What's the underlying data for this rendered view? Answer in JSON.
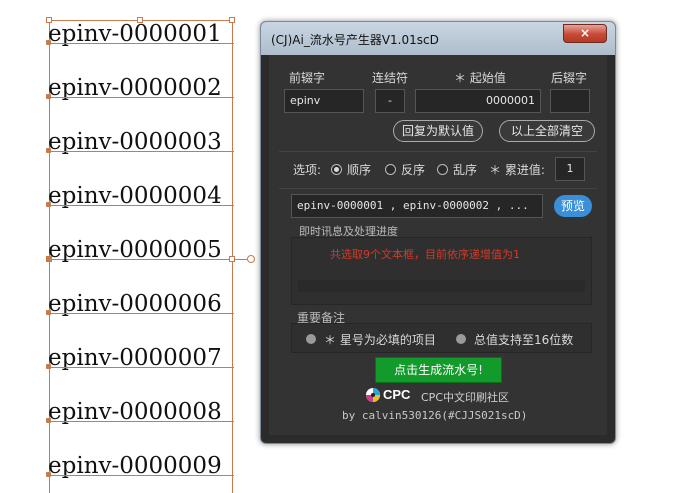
{
  "document": {
    "lines": [
      "epinv-0000001",
      "epinv-0000002",
      "epinv-0000003",
      "epinv-0000004",
      "epinv-0000005",
      "epinv-0000006",
      "epinv-0000007",
      "epinv-0000008",
      "epinv-0000009"
    ],
    "selection_color": "#c87a4a"
  },
  "window": {
    "title": "(CJ)Ai_流水号产生器V1.01scD",
    "close_label": "×"
  },
  "fields": {
    "prefix_label": "前辍字",
    "connector_label": "连结符",
    "start_label": "＊ 起始值",
    "suffix_label": "后辍字",
    "prefix_value": "epinv",
    "connector_value": "-",
    "start_value": "0000001",
    "suffix_value": ""
  },
  "buttons": {
    "reset_default": "回复为默认值",
    "clear_all": "以上全部清空",
    "preview": "预览",
    "generate": "点击生成流水号!"
  },
  "options": {
    "label": "选项:",
    "order_asc": "顺序",
    "order_desc": "反序",
    "order_random": "乱序",
    "step_label": "＊ 累进值:",
    "step_value": "1",
    "selected": "顺序"
  },
  "preview_text": "epinv-0000001 , epinv-0000002 , ...",
  "progress": {
    "title": "即时讯息及处理进度",
    "message": "共选取9个文本框，目前依序递增值为1"
  },
  "notes": {
    "title": "重要备注",
    "note1": "＊ 星号为必填的项目",
    "note2": "总值支持至16位数"
  },
  "footer": {
    "logo_text": "CPC",
    "community": "CPC中文印刷社区",
    "author": "by calvin530126(#CJJS021scD)"
  },
  "colors": {
    "accent_blue": "#3a8fd9",
    "generate_green": "#129b2a",
    "message_red": "#d23a2a"
  }
}
